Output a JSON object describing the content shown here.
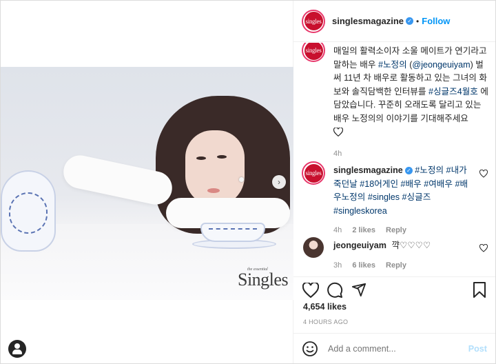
{
  "post": {
    "username": "singlesmagazine",
    "follow_label": "Follow",
    "separator": "•",
    "brand_logo_text": "Singles",
    "brand_logo_sub": "the essential",
    "avatar_text": "singles",
    "next_arrow": "›"
  },
  "caption": {
    "text_1": "매일의 활력소이자 소울 메이트가 연기라고 말하는 배우 ",
    "link_1": "#노정의",
    "text_2": " (",
    "link_2": "@jeongeuiyam",
    "text_3": ") 벌써 11년 차 배우로 활동하고 있는 그녀의 화보와 솔직담백한 인터뷰를 ",
    "link_3": "#싱글즈4월호",
    "text_4": " 에 담았습니다. 꾸준히 오래도록 달리고 있는 배우 노정의의 이야기를 기대해주세요",
    "time": "4h"
  },
  "comments": [
    {
      "username": "singlesmagazine",
      "text": "#노정의 #내가죽던날 #18어게인 #배우 #여배우 #배우노정의 #singles #싱글즈 #singleskorea",
      "time": "4h",
      "likes": "2 likes",
      "reply": "Reply"
    },
    {
      "username": "jeongeuiyam",
      "text": "꺅♡♡♡♡",
      "time": "3h",
      "likes": "6 likes",
      "reply": "Reply"
    }
  ],
  "footer": {
    "likes": "4,654 likes",
    "time": "4 HOURS AGO",
    "add_placeholder": "Add a comment...",
    "post_label": "Post"
  },
  "colors": {
    "accent": "#0095f6",
    "verified": "#3897f0",
    "link": "#00376b",
    "muted": "#8e8e8e"
  },
  "icons": [
    "heart-icon",
    "comment-icon",
    "share-icon",
    "bookmark-icon",
    "emoji-icon",
    "verified-icon",
    "user-icon",
    "chevron-right-icon"
  ]
}
